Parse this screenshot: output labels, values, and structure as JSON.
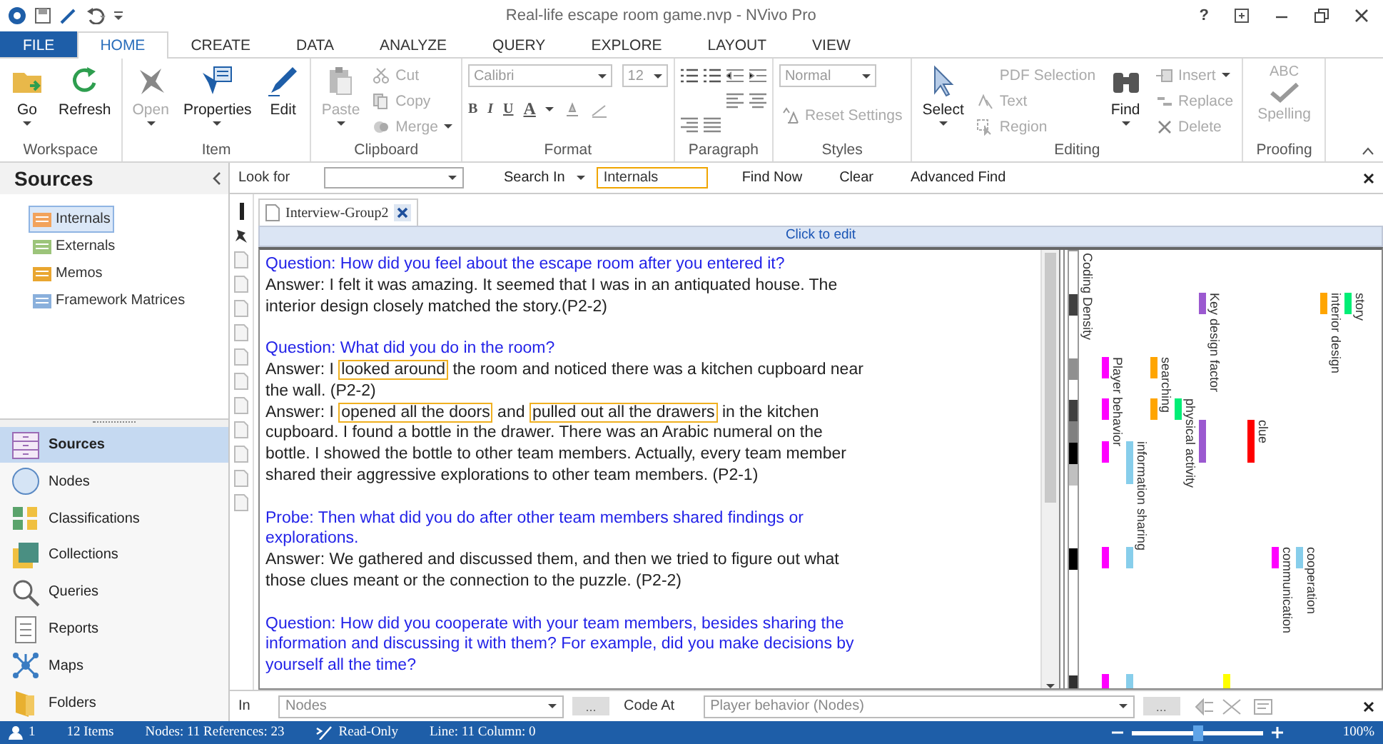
{
  "title_bar": {
    "title": "Real-life escape room game.nvp - NVivo Pro",
    "help": "?"
  },
  "ribbon_tabs": [
    {
      "label": "FILE",
      "kind": "file",
      "selected": false
    },
    {
      "label": "HOME",
      "kind": "tab",
      "selected": true
    },
    {
      "label": "CREATE",
      "kind": "tab",
      "selected": false
    },
    {
      "label": "DATA",
      "kind": "tab",
      "selected": false
    },
    {
      "label": "ANALYZE",
      "kind": "tab",
      "selected": false
    },
    {
      "label": "QUERY",
      "kind": "tab",
      "selected": false
    },
    {
      "label": "EXPLORE",
      "kind": "tab",
      "selected": false
    },
    {
      "label": "LAYOUT",
      "kind": "tab",
      "selected": false
    },
    {
      "label": "VIEW",
      "kind": "tab",
      "selected": false
    }
  ],
  "ribbon_groups": [
    {
      "label": "Workspace",
      "items": [
        {
          "kind": "large",
          "label": "Go",
          "dropdown": true,
          "disabled": false
        },
        {
          "kind": "large",
          "label": "Refresh",
          "dropdown": false,
          "disabled": false
        }
      ]
    },
    {
      "label": "Item",
      "items": [
        {
          "kind": "large",
          "label": "Open",
          "dropdown": true,
          "disabled": true
        },
        {
          "kind": "large",
          "label": "Properties",
          "dropdown": true,
          "disabled": false
        },
        {
          "kind": "large",
          "label": "Edit",
          "dropdown": false,
          "disabled": false
        }
      ]
    },
    {
      "label": "Clipboard",
      "items": [
        {
          "kind": "large",
          "label": "Paste",
          "dropdown": true,
          "disabled": true
        },
        {
          "kind": "small-stack",
          "entries": [
            {
              "label": "Cut",
              "dropdown": false,
              "disabled": true
            },
            {
              "label": "Copy",
              "dropdown": false,
              "disabled": true
            },
            {
              "label": "Merge",
              "dropdown": true,
              "disabled": true
            }
          ]
        }
      ]
    },
    {
      "label": "Format",
      "items": [
        {
          "kind": "format",
          "font": "Calibri",
          "size": "12",
          "bold": "B",
          "italic": "I",
          "underline": "U",
          "font_color": "A"
        }
      ]
    },
    {
      "label": "Paragraph",
      "items": [
        {
          "kind": "paragraph"
        }
      ]
    },
    {
      "label": "Styles",
      "items": [
        {
          "kind": "styles",
          "style": "Normal",
          "reset": "Reset Settings"
        }
      ]
    },
    {
      "label": "Editing",
      "items": [
        {
          "kind": "large",
          "label": "Select",
          "dropdown": true,
          "disabled": false
        },
        {
          "kind": "small-stack",
          "entries": [
            {
              "label": "PDF Selection",
              "dropdown": false,
              "disabled": true
            },
            {
              "label": "Text",
              "dropdown": false,
              "disabled": true
            },
            {
              "label": "Region",
              "dropdown": false,
              "disabled": true
            }
          ]
        },
        {
          "kind": "large",
          "label": "Find",
          "dropdown": true,
          "disabled": false
        },
        {
          "kind": "small-stack",
          "entries": [
            {
              "label": "Insert",
              "dropdown": true,
              "disabled": true
            },
            {
              "label": "Replace",
              "dropdown": false,
              "disabled": true
            },
            {
              "label": "Delete",
              "dropdown": false,
              "disabled": true
            }
          ]
        }
      ]
    },
    {
      "label": "Proofing",
      "items": [
        {
          "kind": "spelling",
          "badge": "ABC",
          "label": "Spelling",
          "disabled": true
        }
      ]
    }
  ],
  "sources_panel": {
    "title": "Sources",
    "tree": [
      {
        "label": "Internals",
        "selected": true
      },
      {
        "label": "Externals",
        "selected": false
      },
      {
        "label": "Memos",
        "selected": false
      },
      {
        "label": "Framework Matrices",
        "selected": false
      }
    ]
  },
  "navigation": [
    {
      "label": "Sources",
      "selected": true
    },
    {
      "label": "Nodes",
      "selected": false
    },
    {
      "label": "Classifications",
      "selected": false
    },
    {
      "label": "Collections",
      "selected": false
    },
    {
      "label": "Queries",
      "selected": false
    },
    {
      "label": "Reports",
      "selected": false
    },
    {
      "label": "Maps",
      "selected": false
    },
    {
      "label": "Folders",
      "selected": false
    }
  ],
  "find_bar": {
    "look_for_label": "Look for",
    "search_in": "Search In",
    "scope": "Internals",
    "find_now": "Find Now",
    "clear": "Clear",
    "advanced_find": "Advanced Find"
  },
  "document": {
    "tab": "Interview-Group2",
    "edit_hint": "Click to edit",
    "lines": [
      {
        "kind": "question",
        "segments": [
          {
            "text": "Question: How did you feel about the escape room after you entered it?",
            "highlighted": false
          }
        ]
      },
      {
        "kind": "answer",
        "segments": [
          {
            "text": "Answer: I felt it was amazing. It seemed that I was in an antiquated house. The",
            "highlighted": false
          }
        ]
      },
      {
        "kind": "answer",
        "segments": [
          {
            "text": "interior design closely matched the story.(P2-2)",
            "highlighted": false
          }
        ]
      },
      {
        "kind": "blank"
      },
      {
        "kind": "question",
        "segments": [
          {
            "text": "Question: What did you do in the room?",
            "highlighted": false
          }
        ]
      },
      {
        "kind": "answer",
        "segments": [
          {
            "text": "Answer: I ",
            "highlighted": false
          },
          {
            "text": "looked around",
            "highlighted": true
          },
          {
            "text": " the room and noticed there was a kitchen cupboard near",
            "highlighted": false
          }
        ]
      },
      {
        "kind": "answer",
        "segments": [
          {
            "text": "the wall. (P2-2)",
            "highlighted": false
          }
        ]
      },
      {
        "kind": "answer",
        "segments": [
          {
            "text": "Answer: I ",
            "highlighted": false
          },
          {
            "text": "opened all the doors",
            "highlighted": true
          },
          {
            "text": " and ",
            "highlighted": false
          },
          {
            "text": "pulled out all the drawers",
            "highlighted": true
          },
          {
            "text": " in the kitchen",
            "highlighted": false
          }
        ]
      },
      {
        "kind": "answer",
        "segments": [
          {
            "text": "cupboard. I found a bottle in the drawer. There was an Arabic numeral on the",
            "highlighted": false
          }
        ]
      },
      {
        "kind": "answer",
        "segments": [
          {
            "text": "bottle. I showed the bottle to other team members. Actually, every team member",
            "highlighted": false
          }
        ]
      },
      {
        "kind": "answer",
        "segments": [
          {
            "text": "shared their aggressive explorations to other team members. (P2-1)",
            "highlighted": false
          }
        ]
      },
      {
        "kind": "blank"
      },
      {
        "kind": "question",
        "segments": [
          {
            "text": "Probe: Then what did you do after other team members shared findings or",
            "highlighted": false
          }
        ]
      },
      {
        "kind": "question",
        "segments": [
          {
            "text": "explorations.",
            "highlighted": false
          }
        ]
      },
      {
        "kind": "answer",
        "segments": [
          {
            "text": "Answer: We gathered and discussed them, and then we tried to figure out what",
            "highlighted": false
          }
        ]
      },
      {
        "kind": "answer",
        "segments": [
          {
            "text": "those clues meant or the connection to the puzzle. (P2-2)",
            "highlighted": false
          }
        ]
      },
      {
        "kind": "blank"
      },
      {
        "kind": "question",
        "segments": [
          {
            "text": "Question: How did you cooperate with your team members, besides sharing the",
            "highlighted": false
          }
        ]
      },
      {
        "kind": "question",
        "segments": [
          {
            "text": "information and discussing it with them? For example, did you make decisions by",
            "highlighted": false
          }
        ]
      },
      {
        "kind": "question",
        "segments": [
          {
            "text": "yourself all the time?",
            "highlighted": false
          }
        ]
      }
    ]
  },
  "coding_stripes": {
    "density_label": "Coding Density",
    "stripes": [
      {
        "label": "Player behavior",
        "color": "#ff00ff"
      },
      {
        "label": "information sharing",
        "color": "#87ceeb"
      },
      {
        "label": "searching",
        "color": "#ffa500"
      },
      {
        "label": "physical activity",
        "color": "#00ee76"
      },
      {
        "label": "Key design factor",
        "color": "#9b59d0"
      },
      {
        "color": "#ffff00"
      },
      {
        "label": "clue",
        "color": "#ff0000"
      },
      {
        "label": "communication",
        "color": "#ff00ff"
      },
      {
        "label": "cooperation",
        "color": "#87ceeb"
      },
      {
        "label": "interior design",
        "color": "#ffa500"
      },
      {
        "label": "story",
        "color": "#00ee76"
      }
    ]
  },
  "coding_bar": {
    "in_label": "In",
    "in_value": "Nodes",
    "browse": "...",
    "code_at_label": "Code At",
    "code_at_value": "Player behavior (Nodes)",
    "browse_2": "..."
  },
  "status_bar": {
    "user_count": "1",
    "items": "12 Items",
    "nodes": "Nodes: 11  References: 23",
    "mode": "Read-Only",
    "position": "Line: 11  Column: 0",
    "zoom": "100%",
    "zoom_level": {
      "level": 0.5
    }
  }
}
